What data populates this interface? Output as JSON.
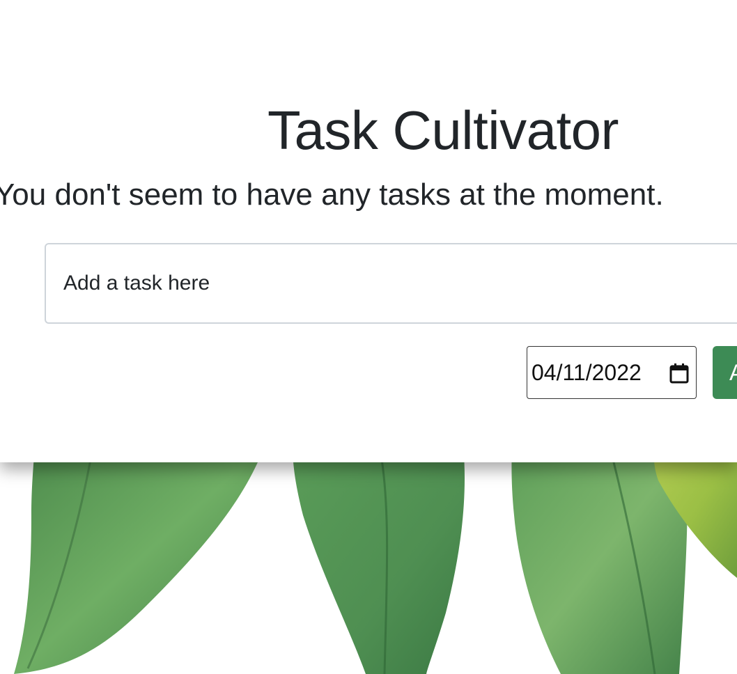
{
  "app": {
    "title": "Task Cultivator",
    "subtitle": "You don't seem to have any tasks at the moment."
  },
  "task_form": {
    "input_placeholder": "Add a task here",
    "input_value": "",
    "date_value": "04/11/2022",
    "add_button_label": "Add"
  },
  "icons": {
    "date_picker": "calendar-icon",
    "background": "green-leaves-illustration"
  },
  "colors": {
    "accent": "#3d8b55",
    "leaf_green": "#4f8f52",
    "leaf_light": "#7db56c",
    "leaf_yellow": "#9bbf45",
    "text": "#212529",
    "input_border": "#ced4da"
  }
}
